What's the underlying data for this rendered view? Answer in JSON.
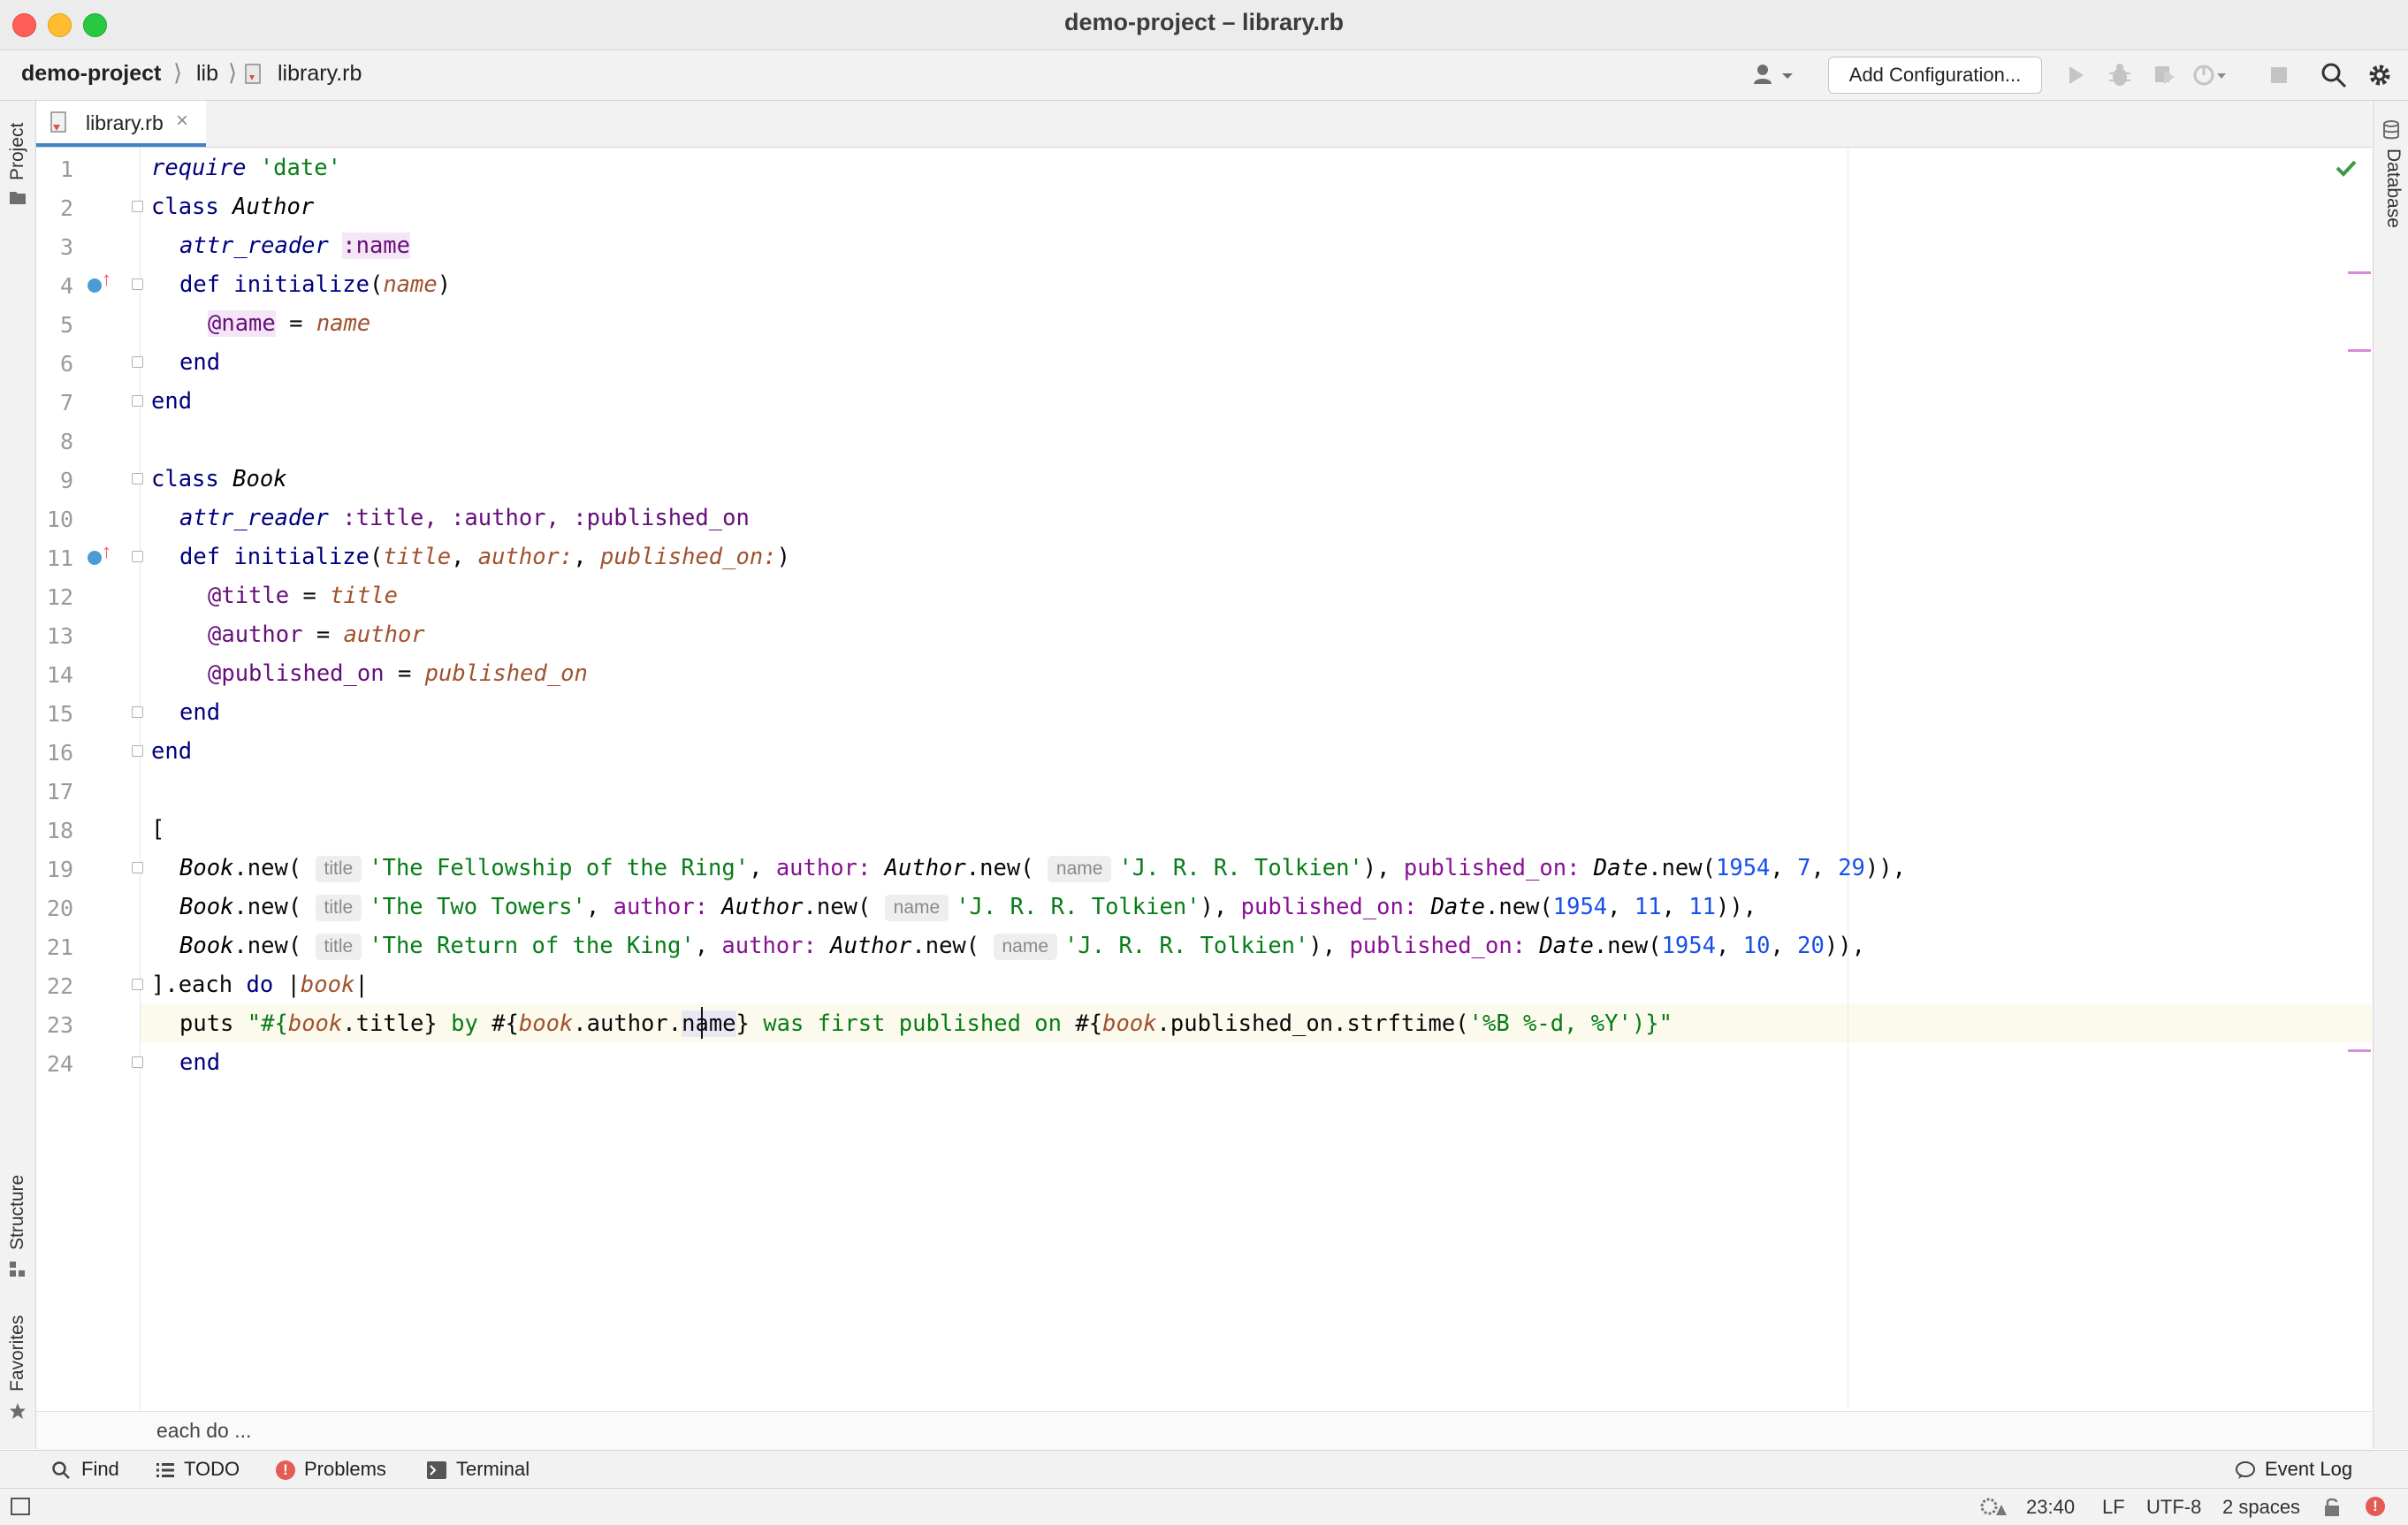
{
  "window": {
    "title": "demo-project – library.rb"
  },
  "navbar": {
    "breadcrumbs": [
      "demo-project",
      "lib",
      "library.rb"
    ],
    "add_configuration": "Add Configuration..."
  },
  "left_tool_tabs": {
    "project": "Project",
    "structure": "Structure",
    "favorites": "Favorites"
  },
  "right_tool_tabs": {
    "database": "Database"
  },
  "editor": {
    "tab_label": "library.rb",
    "line_numbers": [
      "1",
      "2",
      "3",
      "4",
      "5",
      "6",
      "7",
      "8",
      "9",
      "10",
      "11",
      "12",
      "13",
      "14",
      "15",
      "16",
      "17",
      "18",
      "19",
      "20",
      "21",
      "22",
      "23",
      "24"
    ],
    "code": {
      "l1": {
        "kw": "require",
        "str": "'date'"
      },
      "l2": {
        "kw": "class",
        "name": "Author"
      },
      "l3": {
        "method": "attr_reader",
        "sym": ":name"
      },
      "l4": {
        "kw": "def",
        "method": "initialize",
        "open": "(",
        "param": "name",
        "close": ")"
      },
      "l5": {
        "ivar": "@name",
        "op": " = ",
        "param": "name"
      },
      "l6": {
        "kw": "end"
      },
      "l7": {
        "kw": "end"
      },
      "l9": {
        "kw": "class",
        "name": "Book"
      },
      "l10": {
        "method": "attr_reader",
        "syms": ":title, :author, :published_on"
      },
      "l11": {
        "kw": "def",
        "method": "initialize",
        "open": "(",
        "p1": "title",
        "sep1": ", ",
        "p2": "author:",
        "sep2": ", ",
        "p3": "published_on:",
        "close": ")"
      },
      "l12": {
        "ivar": "@title",
        "op": " = ",
        "param": "title"
      },
      "l13": {
        "ivar": "@author",
        "op": " = ",
        "param": "author"
      },
      "l14": {
        "ivar": "@published_on",
        "op": " = ",
        "param": "published_on"
      },
      "l15": {
        "kw": "end"
      },
      "l16": {
        "kw": "end"
      },
      "l18": {
        "text": "["
      },
      "books": [
        {
          "title": "'The Fellowship of the Ring'",
          "author": "'J. R. R. Tolkien'",
          "year": "1954",
          "month": "7",
          "day": "29",
          "tail": ")),"
        },
        {
          "title": "'The Two Towers'",
          "author": "'J. R. R. Tolkien'",
          "year": "1954",
          "month": "11",
          "day": "11",
          "tail": ")),"
        },
        {
          "title": "'The Return of the King'",
          "author": "'J. R. R. Tolkien'",
          "year": "1954",
          "month": "10",
          "day": "20",
          "tail": ")),"
        }
      ],
      "book_call": {
        "cls": "Book",
        "new": ".new(",
        "hint_title": "title",
        "author_label": "author:",
        "author_cls": "Author",
        "hint_name": "name",
        "close_author": "), ",
        "published_label": "published_on:",
        "date_cls": "Date",
        "sep": ", "
      },
      "l22": {
        "open": "].each ",
        "kw": "do",
        "pipe_open": " |",
        "param": "book",
        "pipe_close": "|"
      },
      "l23": {
        "method": "puts",
        "q1": " \"#{",
        "v1": "book",
        "t1": ".title} ",
        "s1": "by ",
        "q2": "#{",
        "v2": "book",
        "t2": ".author.",
        "t2b": "name",
        "t2c": "} ",
        "s2": "was first published on ",
        "q3": "#{",
        "v3": "book",
        "t3": ".published_on.strftime(",
        "fmt": "'%B %-d, %Y'",
        "t4": ")}\""
      },
      "l24": {
        "kw": "end"
      }
    },
    "breadcrumb": "each do ..."
  },
  "tool_windows": {
    "find": "Find",
    "todo": "TODO",
    "problems": "Problems",
    "terminal": "Terminal",
    "event_log": "Event Log"
  },
  "status_bar": {
    "position": "23:40",
    "line_separator": "LF",
    "encoding": "UTF-8",
    "indent": "2 spaces"
  }
}
